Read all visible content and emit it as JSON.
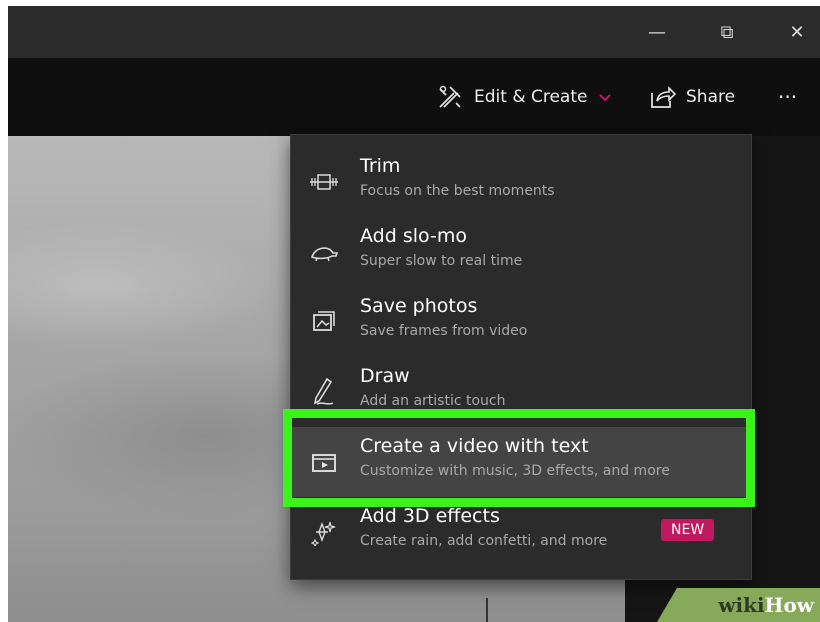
{
  "window_controls": {
    "minimize_glyph": "—",
    "restore_glyph": "⧉",
    "close_glyph": "✕"
  },
  "toolbar": {
    "edit_create_label": "Edit & Create",
    "share_label": "Share",
    "more_glyph": "···",
    "accent_color": "#c1195f"
  },
  "menu": {
    "items": [
      {
        "title": "Trim",
        "subtitle": "Focus on the best moments",
        "icon": "trim-icon"
      },
      {
        "title": "Add slo-mo",
        "subtitle": "Super slow to real time",
        "icon": "slomo-icon"
      },
      {
        "title": "Save photos",
        "subtitle": "Save frames from video",
        "icon": "save-photos-icon"
      },
      {
        "title": "Draw",
        "subtitle": "Add an artistic touch",
        "icon": "draw-icon"
      },
      {
        "title": "Create a video with text",
        "subtitle": "Customize with music, 3D effects, and more",
        "icon": "video-text-icon",
        "highlighted": true
      },
      {
        "title": "Add 3D effects",
        "subtitle": "Create rain, add confetti, and more",
        "icon": "effects-3d-icon",
        "badge": "NEW"
      }
    ],
    "highlight_color": "#3bf21b"
  },
  "watermark": {
    "part1": "wiki",
    "part2": "How"
  }
}
